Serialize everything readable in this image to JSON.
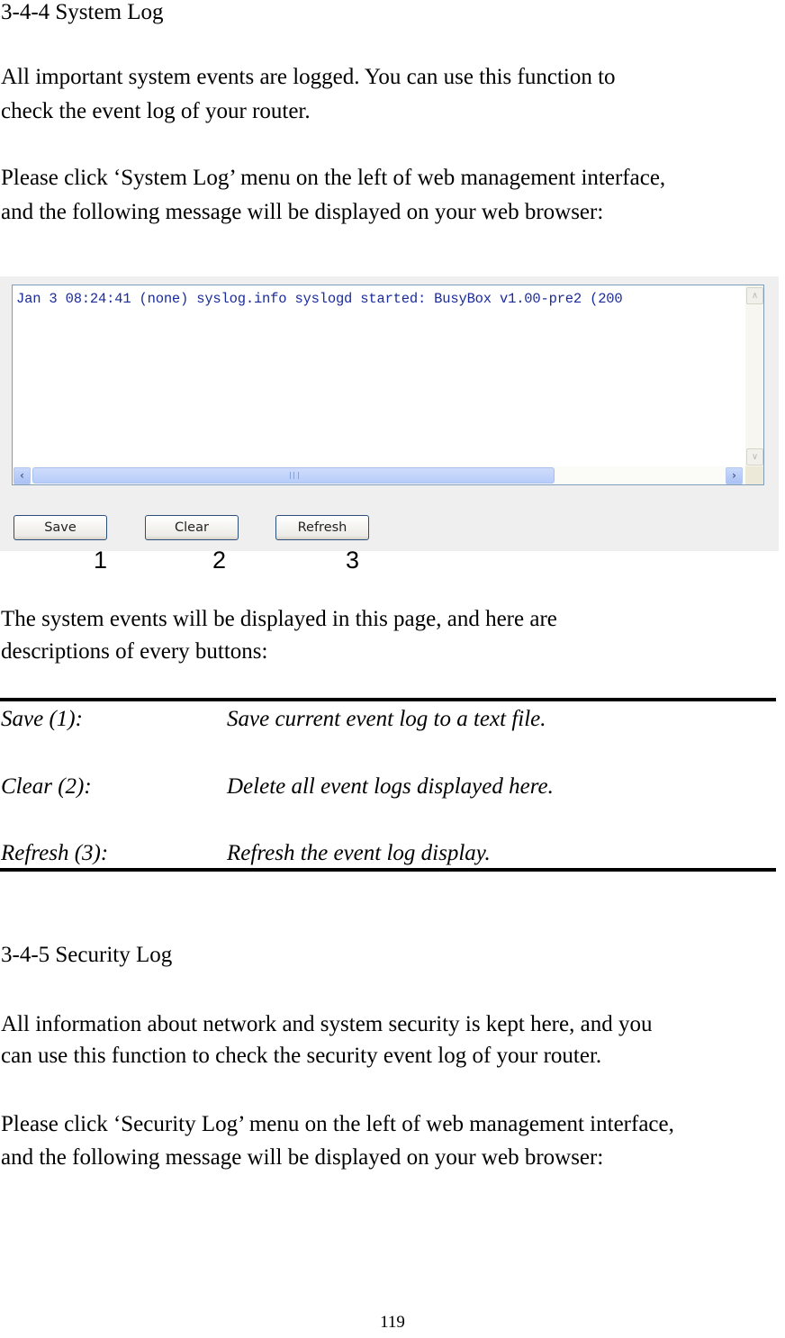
{
  "section1": {
    "heading": "3-4-4 System Log",
    "intro_lines": [
      "All important system events are logged. You can use this function to",
      "check the event log of your router."
    ],
    "instruction_lines": [
      "Please click ‘System Log’ menu on the left of web management interface,",
      "and the following message will be displayed on your web browser:"
    ]
  },
  "screenshot": {
    "log_text": "Jan  3 08:24:41 (none) syslog.info syslogd started: BusyBox v1.00-pre2 (200",
    "scroll_icons": {
      "up": "∧",
      "down": "∨",
      "left": "‹",
      "right": "›"
    },
    "horizontal_scroll_fraction": 0.75,
    "buttons": {
      "save": "Save",
      "clear": "Clear",
      "refresh": "Refresh"
    },
    "callouts": [
      "1",
      "2",
      "3"
    ]
  },
  "after_screenshot_lines": [
    "The system events will be displayed in this page, and here are",
    "descriptions of every buttons:"
  ],
  "descriptions": [
    {
      "term": "Save (1):",
      "desc": "Save current event log to a text file."
    },
    {
      "term": "Clear (2):",
      "desc": "Delete all event logs displayed here."
    },
    {
      "term": "Refresh (3):",
      "desc": "Refresh the event log display."
    }
  ],
  "section2": {
    "heading": "3-4-5 Security Log",
    "intro_lines": [
      "All information about network and system security is kept here, and you",
      "can use this function to check the security event log of your router."
    ],
    "instruction_lines": [
      "Please click ‘Security Log’ menu on the left of web management interface,",
      "and the following message will be displayed on your web browser:"
    ]
  },
  "page_number": "119"
}
